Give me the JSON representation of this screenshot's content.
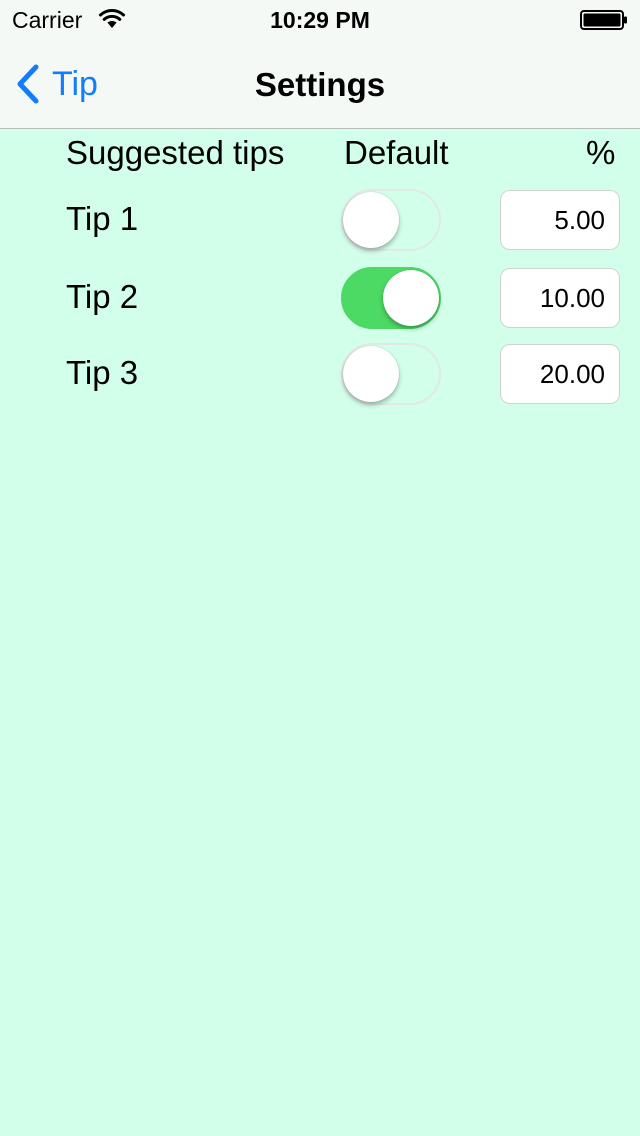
{
  "status_bar": {
    "carrier": "Carrier",
    "time": "10:29 PM",
    "icons": [
      "wifi-icon",
      "battery-icon"
    ]
  },
  "nav": {
    "back_label": "Tip",
    "back_icon": "chevron-left-icon",
    "title": "Settings",
    "accent_color": "#127dfb"
  },
  "table": {
    "headers": {
      "tips": "Suggested tips",
      "default": "Default",
      "percent": "%"
    },
    "rows": [
      {
        "label": "Tip 1",
        "default": false,
        "percent": "5.00"
      },
      {
        "label": "Tip 2",
        "default": true,
        "percent": "10.00"
      },
      {
        "label": "Tip 3",
        "default": false,
        "percent": "20.00"
      }
    ]
  },
  "colors": {
    "background": "#d2ffe9",
    "toggle_on": "#4cd964",
    "bars": "#f5f9f6"
  }
}
